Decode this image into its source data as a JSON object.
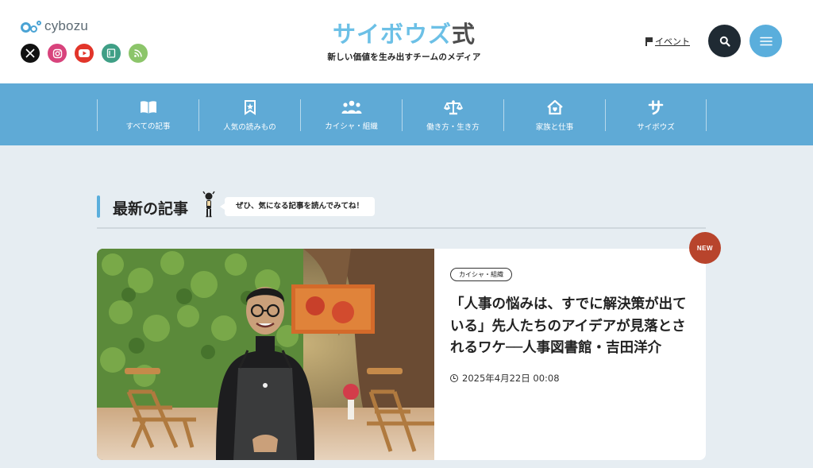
{
  "header": {
    "logo_text": "cybozu",
    "brand_title_main": "サイボウズ",
    "brand_title_suffix": "式",
    "brand_subtitle": "新しい価値を生み出すチームのメディア",
    "event_label": "イベント",
    "social": [
      {
        "icon": "x-icon",
        "glyph": "𝕏"
      },
      {
        "icon": "instagram-icon",
        "glyph": ""
      },
      {
        "icon": "youtube-icon",
        "glyph": "▶"
      },
      {
        "icon": "note-icon",
        "glyph": ""
      },
      {
        "icon": "rss-icon",
        "glyph": ""
      }
    ],
    "search_icon": "search-icon",
    "menu_icon": "hamburger-icon"
  },
  "nav": {
    "items": [
      {
        "label": "すべての記事",
        "icon": "open-book-icon"
      },
      {
        "label": "人気の読みもの",
        "icon": "bookmark-star-icon"
      },
      {
        "label": "カイシャ・組織",
        "icon": "people-group-icon"
      },
      {
        "label": "働き方・生き方",
        "icon": "scales-icon"
      },
      {
        "label": "家族と仕事",
        "icon": "home-heart-icon"
      },
      {
        "label": "サイボウズ",
        "icon": "sa-icon"
      }
    ]
  },
  "section": {
    "title": "最新の記事",
    "bubble": "ぜひ、気になる記事を読んでみてね！"
  },
  "article": {
    "badge": "NEW",
    "tag": "カイシャ・組織",
    "title": "「人事の悩みは、すでに解決策が出ている」先人たちのアイデアが見落とされるワケ──人事図書館・吉田洋介",
    "date": "2025年4月22日 00:08"
  },
  "colors": {
    "brand_blue": "#5faad6",
    "brand_light": "#6cc0e6",
    "new_badge": "#b8442c",
    "background": "#e6edf2"
  }
}
